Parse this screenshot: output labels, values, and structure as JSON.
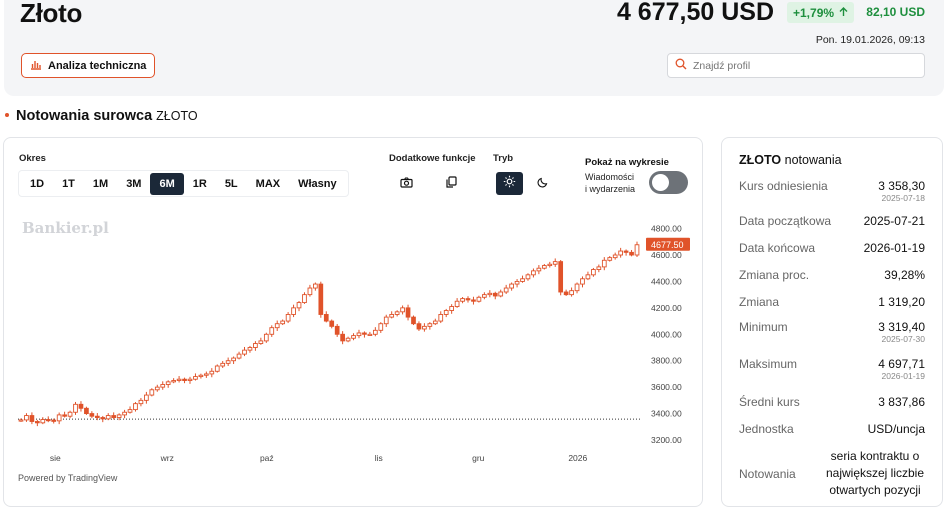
{
  "header": {
    "title": "Złoto",
    "price": "4 677,50 USD",
    "change_pct": "+1,79%",
    "change_abs": "82,10 USD",
    "datetime": "Pon. 19.01.2026, 09:13",
    "analysis_button": "Analiza techniczna",
    "search_placeholder": "Znajdź profil"
  },
  "section": {
    "title": "Notowania surowca",
    "subtitle": "ZŁOTO"
  },
  "toolbar": {
    "period_label": "Okres",
    "periods": [
      "1D",
      "1T",
      "1M",
      "3M",
      "6M",
      "1R",
      "5L",
      "MAX",
      "Własny"
    ],
    "active_period": "6M",
    "extra_label": "Dodatkowe funkcje",
    "mode_label": "Tryb",
    "show_label": "Pokaż na wykresie",
    "news_label_1": "Wiadomości",
    "news_label_2": "i wydarzenia",
    "news_toggle": "off"
  },
  "colors": {
    "accent": "#e0532a",
    "positive": "#1e8f3e",
    "dark_button": "#1b2838"
  },
  "chart_data": {
    "type": "candlestick",
    "watermark": "Bankier.pl",
    "credit": "Powered by TradingView",
    "x_tick_labels": [
      "sie",
      "wrz",
      "paź",
      "lis",
      "gru",
      "2026"
    ],
    "x_tick_positions": [
      2025.58,
      2025.67,
      2025.75,
      2025.84,
      2025.92,
      2026.0
    ],
    "x_range": [
      2025.55,
      2026.05
    ],
    "y_ticks": [
      4800,
      4600,
      4400,
      4200,
      4000,
      3800,
      3600,
      3400,
      3200
    ],
    "y_tick_labels": [
      "4800.00",
      "4600.00",
      "4400.00",
      "4200.00",
      "4000.00",
      "3800.00",
      "3600.00",
      "3400.00",
      "3200.00"
    ],
    "ylim": [
      3200,
      4880
    ],
    "reference_line": 3358.3,
    "last_price_label": "4677.50",
    "last_price": 4677.5,
    "close_series": [
      3352,
      3385,
      3340,
      3330,
      3355,
      3350,
      3345,
      3390,
      3380,
      3410,
      3470,
      3440,
      3400,
      3380,
      3370,
      3360,
      3385,
      3370,
      3390,
      3410,
      3430,
      3475,
      3500,
      3540,
      3580,
      3600,
      3620,
      3640,
      3650,
      3660,
      3650,
      3660,
      3680,
      3690,
      3700,
      3720,
      3760,
      3780,
      3800,
      3820,
      3850,
      3880,
      3900,
      3930,
      3950,
      4000,
      4050,
      4080,
      4100,
      4150,
      4200,
      4240,
      4300,
      4350,
      4380,
      4150,
      4100,
      4060,
      4000,
      3950,
      3970,
      3990,
      4010,
      4000,
      4000,
      4030,
      4080,
      4130,
      4150,
      4170,
      4200,
      4130,
      4080,
      4040,
      4060,
      4080,
      4100,
      4150,
      4180,
      4210,
      4250,
      4270,
      4260,
      4250,
      4280,
      4300,
      4310,
      4290,
      4320,
      4350,
      4380,
      4400,
      4420,
      4450,
      4480,
      4500,
      4520,
      4530,
      4550,
      4320,
      4300,
      4330,
      4380,
      4420,
      4450,
      4490,
      4510,
      4560,
      4580,
      4600,
      4630,
      4620,
      4600,
      4677.5
    ]
  },
  "sidebar": {
    "title": "ZŁOTO",
    "title_suffix": "notowania",
    "rows": [
      {
        "key": "Kurs odniesienia",
        "value": "3 358,30",
        "date": "2025-07-18"
      },
      {
        "key": "Data początkowa",
        "value": "2025-07-21"
      },
      {
        "key": "Data końcowa",
        "value": "2026-01-19"
      },
      {
        "key": "Zmiana proc.",
        "value": "39,28%"
      },
      {
        "key": "Zmiana",
        "value": "1 319,20"
      },
      {
        "key": "Minimum",
        "value": "3 319,40",
        "date": "2025-07-30"
      },
      {
        "key": "Maksimum",
        "value": "4 697,71",
        "date": "2026-01-19"
      },
      {
        "key": "Średni kurs",
        "value": "3 837,86"
      },
      {
        "key": "Jednostka",
        "value": "USD/uncja"
      },
      {
        "key": "Notowania",
        "value": "seria kontraktu o największej liczbie otwartych pozycji"
      }
    ]
  }
}
